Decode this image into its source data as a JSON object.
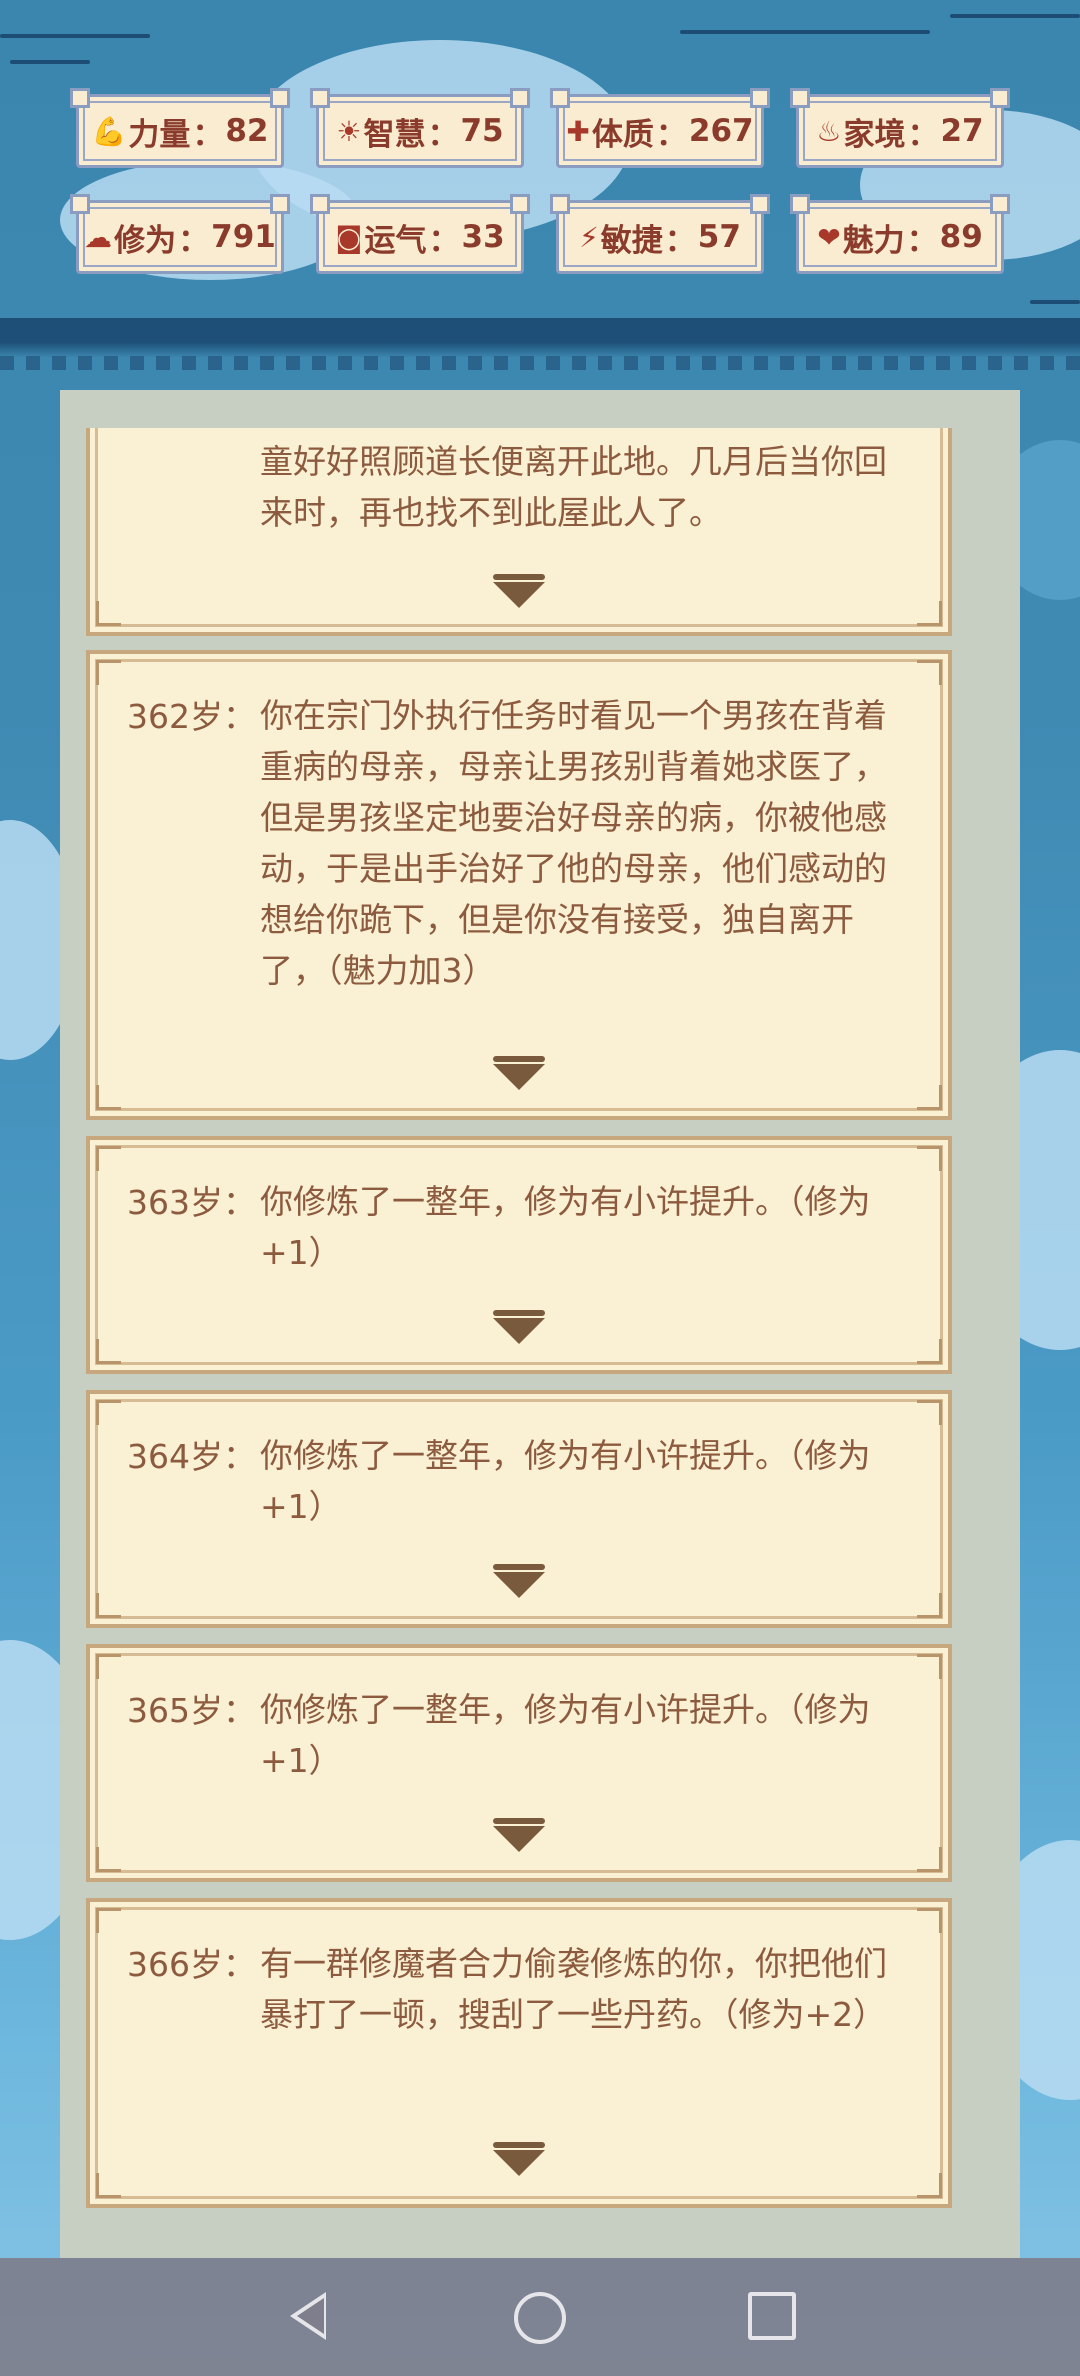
{
  "stats": [
    {
      "icon": "arm-icon",
      "glyph": "💪",
      "label": "力量",
      "value": "82"
    },
    {
      "icon": "lightbulb-icon",
      "glyph": "☀",
      "label": "智慧",
      "value": "75"
    },
    {
      "icon": "body-icon",
      "glyph": "✚",
      "label": "体质",
      "value": "267"
    },
    {
      "icon": "money-bag-icon",
      "glyph": "♨",
      "label": "家境",
      "value": "27"
    },
    {
      "icon": "cloud-icon",
      "glyph": "☁",
      "label": "修为",
      "value": "791"
    },
    {
      "icon": "luck-icon",
      "glyph": "◙",
      "label": "运气",
      "value": "33"
    },
    {
      "icon": "lightning-icon",
      "glyph": "⚡",
      "label": "敏捷",
      "value": "57"
    },
    {
      "icon": "heart-icon",
      "glyph": "❤",
      "label": "魅力",
      "value": "89"
    }
  ],
  "separator": "：",
  "events": [
    {
      "age": "",
      "text": "童好好照顾道长便离开此地。几月后当你回来时，再也找不到此屋此人了。"
    },
    {
      "age": "362岁：",
      "text": "你在宗门外执行任务时看见一个男孩在背着重病的母亲，母亲让男孩别背着她求医了，但是男孩坚定地要治好母亲的病，你被他感动，于是出手治好了他的母亲，他们感动的想给你跪下，但是你没有接受，独自离开了，（魅力加3）"
    },
    {
      "age": "363岁：",
      "text": "你修炼了一整年，修为有小许提升。（修为+1）"
    },
    {
      "age": "364岁：",
      "text": "你修炼了一整年，修为有小许提升。（修为+1）"
    },
    {
      "age": "365岁：",
      "text": "你修炼了一整年，修为有小许提升。（修为+1）"
    },
    {
      "age": "366岁：",
      "text": "有一群修魔者合力偷袭修炼的你，你把他们暴打了一顿，搜刮了一些丹药。（修为+2）"
    }
  ],
  "colors": {
    "accent": "#8a3b2b",
    "card_bg": "#faf0d3",
    "text": "#8c5a3e",
    "sky": "#3f8fb8"
  }
}
